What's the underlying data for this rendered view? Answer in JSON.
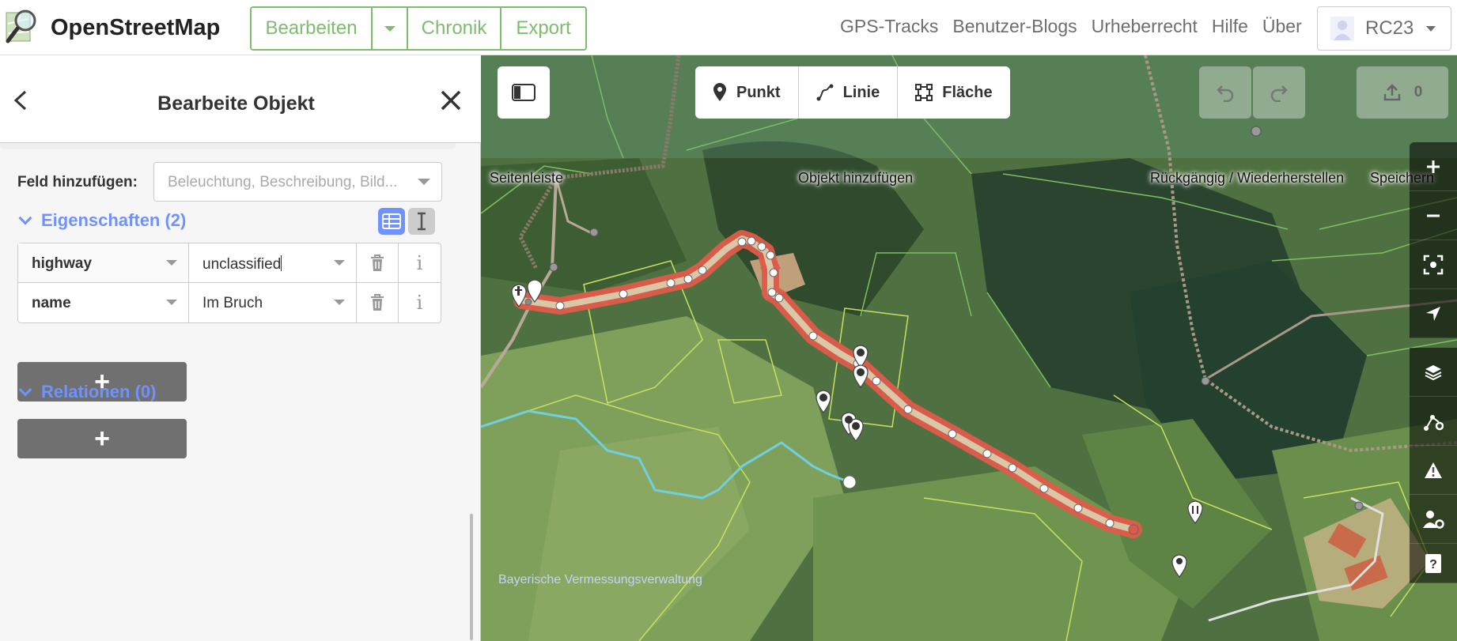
{
  "navbar": {
    "brand": "OpenStreetMap",
    "buttons": {
      "edit": "Bearbeiten",
      "history": "Chronik",
      "export": "Export"
    },
    "links": [
      "GPS-Tracks",
      "Benutzer-Blogs",
      "Urheberrecht",
      "Hilfe",
      "Über"
    ],
    "user": "RC23"
  },
  "sidebar": {
    "title": "Bearbeite Objekt",
    "back_icon": "chevron-left-icon",
    "close_icon": "close-icon",
    "add_field": {
      "label": "Feld hinzufügen:",
      "placeholder": "Beleuchtung, Beschreibung, Bild..."
    },
    "tags_section": {
      "title": "Eigenschaften (2)"
    },
    "tags": [
      {
        "key": "highway",
        "value": "unclassified"
      },
      {
        "key": "name",
        "value": "Im Bruch"
      }
    ],
    "add_tag_label": "+",
    "relations_section": {
      "title": "Relationen (0)"
    },
    "add_relation_label": "+"
  },
  "map": {
    "toolbar": {
      "sidebar_label": "Seitenleiste",
      "add_point": "Punkt",
      "add_line": "Linie",
      "add_area": "Fläche",
      "add_label": "Objekt hinzufügen",
      "undo_redo_label": "Rückgängig / Wiederherstellen",
      "save_label": "Speichern",
      "save_count": "0"
    },
    "controls": [
      "zoom-in-icon",
      "zoom-out-icon",
      "zoom-to-selection-icon",
      "geolocate-icon",
      "layers-icon",
      "map-data-icon",
      "issues-icon",
      "preferences-icon",
      "help-icon"
    ],
    "attribution": "Bayerische Vermessungsverwaltung",
    "colors": {
      "selected_way": "#e06050",
      "way_fill": "#d9c8a8",
      "stream": "#6fd0e0",
      "accent": "#7092ff",
      "osm_green": "#7ebc6f"
    }
  }
}
